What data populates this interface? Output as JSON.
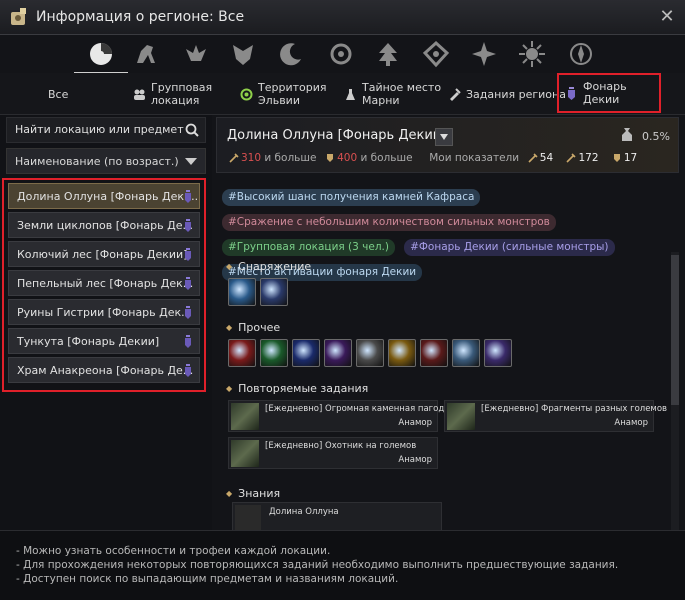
{
  "window": {
    "title": "Информация о регионе: Все"
  },
  "category_icons": [
    "pie-chart-icon",
    "horse-icon",
    "griffin-icon",
    "crest-icon",
    "moon-icon",
    "emblem-icon",
    "temple-icon",
    "star-icon",
    "sun-icon",
    "compass-icon"
  ],
  "tabs": [
    {
      "label": "Все"
    },
    {
      "label": "Групповая\nлокация"
    },
    {
      "label": "Территория\nЭльвии"
    },
    {
      "label": "Тайное место\nМарни"
    },
    {
      "label": "Задания региона"
    },
    {
      "label": "Фонарь Декии"
    }
  ],
  "sidebar": {
    "search_placeholder": "Найти локацию или предмет",
    "sort_label": "Наименование (по возраст.)",
    "locations": [
      {
        "label": "Долина Оллуна [Фонарь Деки..."
      },
      {
        "label": "Земли циклопов [Фонарь Де..."
      },
      {
        "label": "Колючий лес [Фонарь Декии]"
      },
      {
        "label": "Пепельный лес [Фонарь Дек..."
      },
      {
        "label": "Руины Гистрии [Фонарь Дек..."
      },
      {
        "label": "Тункута [Фонарь Декии]"
      },
      {
        "label": "Храм Анакреона [Фонарь Де..."
      }
    ]
  },
  "detail": {
    "title": "Долина Оллуна [Фонарь Декии]",
    "drop_rate": "0.5%",
    "ap_value": "310",
    "ap_suffix": "и больше",
    "dp_value": "400",
    "dp_suffix": "и больше",
    "my_stats_label": "Мои показатели",
    "my_ap": "54",
    "my_aap": "172",
    "my_dp": "17",
    "tags": [
      {
        "label": "#Высокий шанс получения камней Кафраса",
        "color": "#bcd8f0",
        "bg": "#2c3e50"
      },
      {
        "label": "#Сражение с небольшим количеством сильных монстров",
        "color": "#d08a9a",
        "bg": "#3d2a30"
      },
      {
        "label": "#Групповая локация (3 чел.)",
        "color": "#7cd08a",
        "bg": "#203a28"
      },
      {
        "label": "#Фонарь Декии (сильные монстры)",
        "color": "#a79ee8",
        "bg": "#2b2a4a"
      },
      {
        "label": "#Место активации фонаря Декии",
        "color": "#bcd8f0",
        "bg": "#253748"
      }
    ],
    "sections": {
      "equipment": "Снаряжение",
      "other": "Прочее",
      "quests": "Повторяемые задания",
      "knowledge": "Знания"
    },
    "equipment_items": [
      "#2a5a8a",
      "#2a3a6a"
    ],
    "other_items": [
      "#7a1a1a",
      "#1a5a2a",
      "#1a2a6a",
      "#3a1a5a",
      "#4a4a4a",
      "#7a5a10",
      "#5a1a1a",
      "#3a5a7a",
      "#3a2a6a"
    ],
    "quests": [
      {
        "title": "[Ежедневно] Огромная каменная пагода",
        "npc": "Анамор"
      },
      {
        "title": "[Ежедневно] Фрагменты разных големов",
        "npc": "Анамор"
      },
      {
        "title": "[Ежедневно] Охотник на големов",
        "npc": "Анамор"
      }
    ],
    "knowledge": [
      {
        "title": "Долина Оллуна"
      }
    ]
  },
  "footer": {
    "lines": [
      "- Можно узнать особенности и трофеи каждой локации.",
      "- Для прохождения некоторых повторяющихся заданий необходимо выполнить предшествующие задания.",
      "- Доступен поиск по выпадающим предметам и названиям локаций."
    ]
  }
}
